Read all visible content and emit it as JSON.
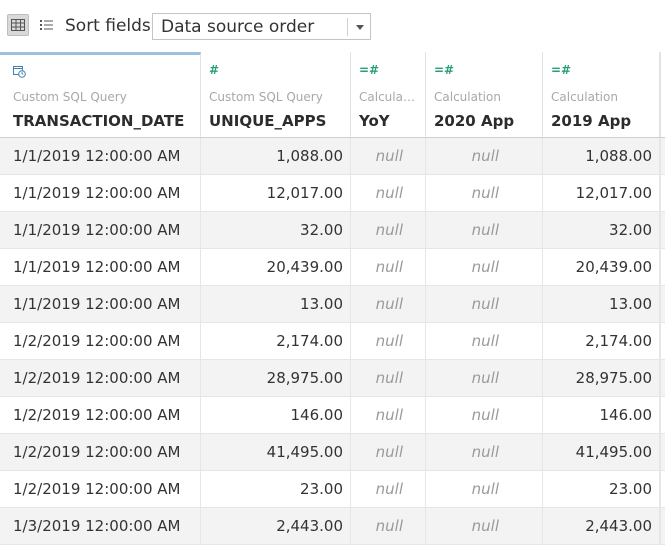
{
  "toolbar": {
    "sort_label": "Sort fields",
    "sort_value": "Data source order",
    "grid_view_icon": "grid-view-icon",
    "list_view_icon": "list-view-icon",
    "dropdown_icon": "chevron-down-icon"
  },
  "columns": [
    {
      "type_icon": "date-time-icon",
      "source": "Custom SQL Query",
      "name": "TRANSACTION_DATE"
    },
    {
      "type_icon": "number-icon",
      "source": "Custom SQL Query",
      "name": "UNIQUE_APPS"
    },
    {
      "type_icon": "calculated-number-icon",
      "source": "Calculati...",
      "name": "YoY"
    },
    {
      "type_icon": "calculated-number-icon",
      "source": "Calculation",
      "name": "2020 App"
    },
    {
      "type_icon": "calculated-number-icon",
      "source": "Calculation",
      "name": "2019 App"
    }
  ],
  "rows": [
    [
      "1/1/2019 12:00:00 AM",
      "1,088.00",
      "null",
      "null",
      "1,088.00"
    ],
    [
      "1/1/2019 12:00:00 AM",
      "12,017.00",
      "null",
      "null",
      "12,017.00"
    ],
    [
      "1/1/2019 12:00:00 AM",
      "32.00",
      "null",
      "null",
      "32.00"
    ],
    [
      "1/1/2019 12:00:00 AM",
      "20,439.00",
      "null",
      "null",
      "20,439.00"
    ],
    [
      "1/1/2019 12:00:00 AM",
      "13.00",
      "null",
      "null",
      "13.00"
    ],
    [
      "1/2/2019 12:00:00 AM",
      "2,174.00",
      "null",
      "null",
      "2,174.00"
    ],
    [
      "1/2/2019 12:00:00 AM",
      "28,975.00",
      "null",
      "null",
      "28,975.00"
    ],
    [
      "1/2/2019 12:00:00 AM",
      "146.00",
      "null",
      "null",
      "146.00"
    ],
    [
      "1/2/2019 12:00:00 AM",
      "41,495.00",
      "null",
      "null",
      "41,495.00"
    ],
    [
      "1/2/2019 12:00:00 AM",
      "23.00",
      "null",
      "null",
      "23.00"
    ],
    [
      "1/3/2019 12:00:00 AM",
      "2,443.00",
      "null",
      "null",
      "2,443.00"
    ]
  ],
  "colors": {
    "date_icon": "#3d82b8",
    "number_icon": "#2aa072",
    "selected_header": "#9cc0e0",
    "null_text": "#9a9a9a",
    "row_shade": "#f3f3f3"
  }
}
